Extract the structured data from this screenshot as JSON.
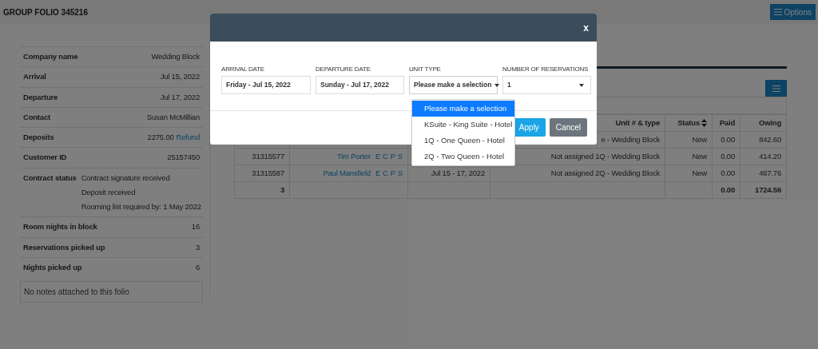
{
  "header": {
    "title": "GROUP FOLIO 345216",
    "options_button": "Options"
  },
  "summary": [
    {
      "label": "Company name",
      "values": [
        "Wedding Block"
      ]
    },
    {
      "label": "Arrival",
      "values": [
        "Jul 15, 2022"
      ]
    },
    {
      "label": "Departure",
      "values": [
        "Jul 17, 2022"
      ]
    },
    {
      "label": "Contact",
      "values": [
        "Susan McMillian"
      ]
    },
    {
      "label": "Deposits",
      "values": [
        "2275.00"
      ],
      "link": "Refund"
    },
    {
      "label": "Customer ID",
      "values": [
        "25157450"
      ]
    },
    {
      "label": "Contract status",
      "values": [
        "Contract signature received",
        "Deposit received",
        "Rooming list required by: 1 May 2022"
      ]
    },
    {
      "label": "Room nights in block",
      "values": [
        "16"
      ]
    },
    {
      "label": "Reservations picked up",
      "values": [
        "3"
      ]
    },
    {
      "label": "Nights picked up",
      "values": [
        "6"
      ]
    }
  ],
  "notes": "No notes attached to this folio",
  "table": {
    "columns": [
      {
        "label": "Unit # & type",
        "sortable": false
      },
      {
        "label": "Status",
        "sortable": true
      },
      {
        "label": "Paid",
        "sortable": false
      },
      {
        "label": "Owing",
        "sortable": false
      }
    ],
    "rows": [
      {
        "unit": "e - Wedding Block",
        "status": "New",
        "paid": "0.00",
        "owing": "842.60"
      },
      {
        "id": "31315577",
        "guest": "Tim Porter",
        "links": [
          "E",
          "C",
          "P",
          "S"
        ],
        "unit": "Not assigned 1Q - Wedding Block",
        "status": "New",
        "paid": "0.00",
        "owing": "414.20"
      },
      {
        "id": "31315587",
        "guest": "Paul Mansfield",
        "links": [
          "E",
          "C",
          "P",
          "S"
        ],
        "dates": "Jul 15 - 17, 2022",
        "unit": "Not assigned 2Q - Wedding Block",
        "status": "New",
        "paid": "0.00",
        "owing": "467.76"
      }
    ],
    "totals": {
      "count": "3",
      "paid": "0.00",
      "owing": "1724.56"
    }
  },
  "modal": {
    "close": "x",
    "fields": [
      {
        "kind": "date",
        "label": "ARRIVAL DATE",
        "value": "Friday - Jul 15, 2022"
      },
      {
        "kind": "date",
        "label": "DEPARTURE DATE",
        "value": "Sunday - Jul 17, 2022"
      },
      {
        "kind": "select",
        "label": "UNIT TYPE",
        "value": "Please make a selection",
        "expanded": true,
        "options": [
          {
            "label": "Please make a selection",
            "selected": true
          },
          {
            "label": "KSuite - King Suite - Hotel",
            "selected": false
          },
          {
            "label": "1Q - One Queen - Hotel",
            "selected": false
          },
          {
            "label": "2Q - Two Queen - Hotel",
            "selected": false
          }
        ]
      },
      {
        "kind": "select",
        "label": "NUMBER OF RESERVATIONS",
        "value": "1",
        "expanded": false
      }
    ],
    "buttons": [
      {
        "kind": "primary",
        "label": "Apply"
      },
      {
        "kind": "secondary",
        "label": "Cancel"
      }
    ]
  }
}
